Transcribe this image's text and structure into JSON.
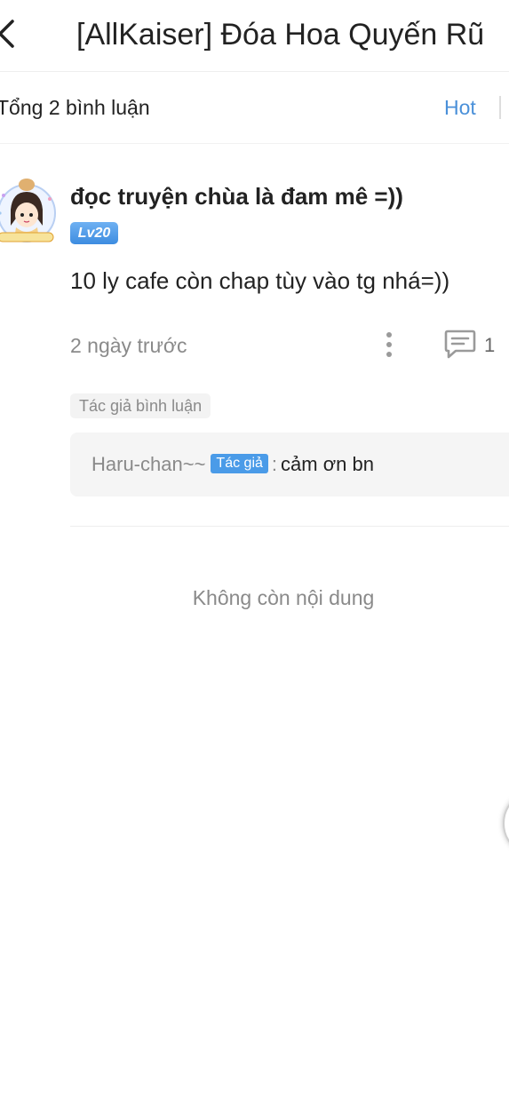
{
  "header": {
    "title": "[AllKaiser] Đóa Hoa Quyến Rũ",
    "back_icon": "chevron-left-icon"
  },
  "summary": {
    "total_label": "Tổng 2 bình luận",
    "sort_label": "Hot"
  },
  "comment": {
    "username": "đọc truyện chùa là đam mê =))",
    "level": "Lv20",
    "text": "10 ly cafe còn chap tùy vào tg nhá=))",
    "timestamp": "2 ngày trước",
    "reply_count": "1",
    "author_tag": "Tác giả bình luận",
    "reply": {
      "author": "Haru-chan~~",
      "author_badge": "Tác giả",
      "separator": ":",
      "text": "cảm ơn bn"
    }
  },
  "footer": {
    "end_message": "Không còn nội dung"
  },
  "colors": {
    "accent": "#4a90d9",
    "badge": "#4a9be8",
    "muted_text": "#8a8a8a"
  }
}
